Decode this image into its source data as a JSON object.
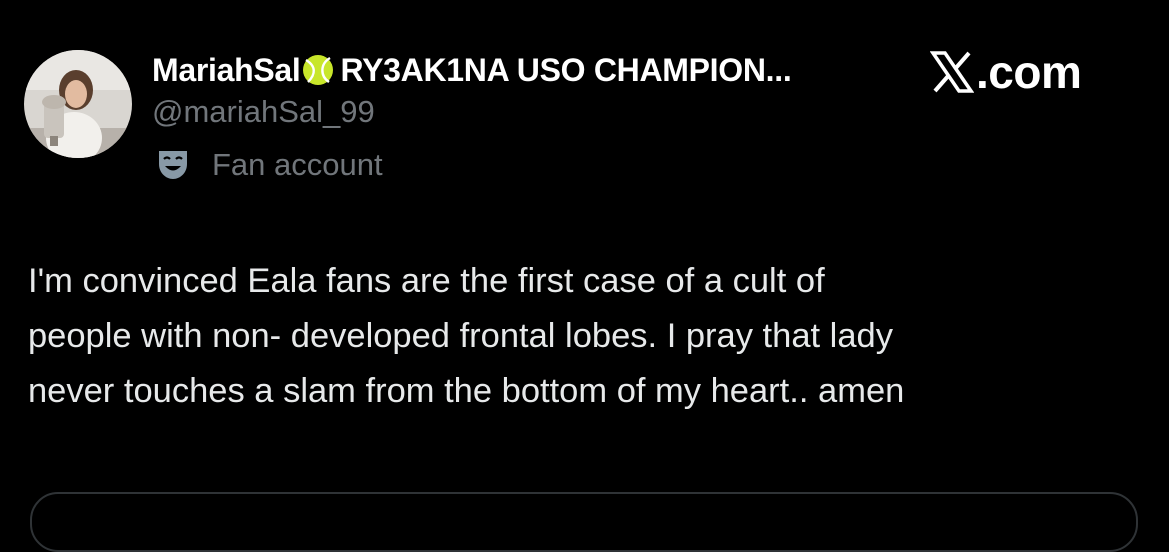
{
  "tweet": {
    "author": {
      "display_name": "MariahSal",
      "badge_icon": "tennis-ball-icon",
      "display_suffix": "RY3AK1NA USO CHAMPION...",
      "handle": "@mariahSal_99",
      "label_icon": "theater-mask-icon",
      "account_label": "Fan account"
    },
    "brand": {
      "logo_icon": "x-logo-icon",
      "text": ".com"
    },
    "text": "I'm convinced Eala fans are the first case of a cult of\npeople with non- developed frontal lobes. I pray that lady\nnever touches a slam from the bottom of my heart.. amen"
  },
  "colors": {
    "background": "#000000",
    "primary_text": "#e7e9ea",
    "secondary_text": "#71767b",
    "ball": "#c8e62a",
    "border": "#2f3336"
  }
}
